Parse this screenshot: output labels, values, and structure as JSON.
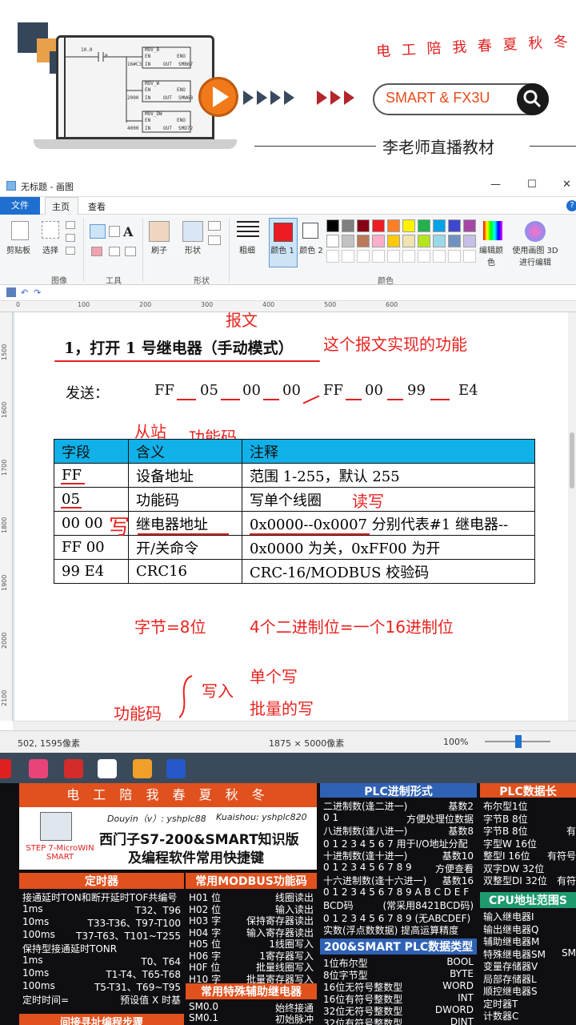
{
  "banner": {
    "slogan": "电 工 陪 我 春 夏 秋 冬",
    "search_text": "SMART & FX3U",
    "teacher": "李老师直播教材",
    "ladder": {
      "contact": "10.0",
      "p": "P",
      "blocks": [
        {
          "name": "MOV_B",
          "in_val": "16#C3",
          "out": "SMB67"
        },
        {
          "name": "MOV_W",
          "in_val": "2000",
          "out": "SMW68"
        },
        {
          "name": "MOV_DW",
          "in_val": "4000",
          "out": "SMD72"
        }
      ],
      "en": "EN",
      "eno": "ENO",
      "in_lbl": "IN",
      "out_lbl": "OUT"
    }
  },
  "window": {
    "title": "无标题 - 画图",
    "tabs": {
      "file": "文件",
      "home": "主页",
      "view": "查看"
    },
    "ribbon": {
      "clipboard": "剪贴板",
      "select": "选择",
      "image_group": "图像",
      "tools_group": "工具",
      "brush": "刷子",
      "shapes": "形状",
      "shapes_group": "形状",
      "size": "粗细",
      "color1": "颜色 1",
      "color2": "颜色 2",
      "colors_group": "颜色",
      "edit_colors": "编辑颜色",
      "paint3d": "使用画图 3D 进行编辑"
    },
    "palette": [
      "#000000",
      "#7f7f7f",
      "#880015",
      "#ed1c24",
      "#ff7f27",
      "#fff200",
      "#22b14c",
      "#00a2e8",
      "#3f48cc",
      "#a349a4",
      "#ffffff",
      "#c3c3c3",
      "#b97a57",
      "#ffaec9",
      "#ffc90e",
      "#efe4b0",
      "#b5e61d",
      "#99d9ea",
      "#7092be",
      "#c8bfe7"
    ],
    "ruler_h": [
      "0",
      "100",
      "200",
      "300",
      "400",
      "500",
      "600"
    ],
    "ruler_v": [
      "1500",
      "1600",
      "1700",
      "1800",
      "1900",
      "2000",
      "2100"
    ],
    "status": {
      "cursor": "502, 1595像素",
      "size": "1875 × 5000像素",
      "zoom": "100%"
    }
  },
  "doc": {
    "heading": "1，打开 1 号继电器（手动模式）",
    "send_label": "发送：",
    "hex_bytes": [
      "FF",
      "05",
      "00",
      "00",
      "FF",
      "00",
      "99",
      "E4"
    ],
    "table": {
      "headers": [
        "字段",
        "含义",
        "注释"
      ],
      "rows": [
        [
          "FF",
          "设备地址",
          "范围 1-255，默认 255"
        ],
        [
          "05",
          "功能码",
          "写单个线圈"
        ],
        [
          "00 00",
          "继电器地址",
          "0x0000--0x0007 分别代表#1 继电器--"
        ],
        [
          "FF 00",
          "开/关命令",
          "0x0000 为关，0xFF00 为开"
        ],
        [
          "99 E4",
          "CRC16",
          "CRC-16/MODBUS 校验码"
        ]
      ]
    },
    "annotations": {
      "baowen": "报文",
      "func_desc": "这个报文实现的功能",
      "slave": "从站",
      "func_code": "功能码",
      "rw": "读写",
      "write_char": "写",
      "byte_note": "字节=8位",
      "bit_note": "4个二进制位=一个16进制位",
      "single_write": "单个写",
      "write_in": "写入",
      "batch_write": "批量的写",
      "func_code2": "功能码"
    }
  },
  "bottom": {
    "banner_slogan": "电 工 陪 我 春 夏 秋 冬",
    "douyin": "Douyin（v）: yshplc88",
    "kuaishou": "Kuaishou: yshplc820",
    "title1": "西门子S7-200&SMART知识版",
    "title2": "及编程软件常用快捷键",
    "software": "STEP 7-MicroWIN SMART",
    "timer": {
      "title": "定时器",
      "rows": [
        [
          "接通延时TON和断开延时TOF共编号",
          ""
        ],
        [
          "1ms",
          "T32、T96"
        ],
        [
          "10ms",
          "T33-T36、T97-T100"
        ],
        [
          "100ms",
          "T37-T63、T101~T255"
        ],
        [
          "保持型接通延时TONR",
          ""
        ],
        [
          "1ms",
          "T0、T64"
        ],
        [
          "10ms",
          "T1-T4、T65-T68"
        ],
        [
          "100ms",
          "T5-T31、T69~T95"
        ],
        [
          "定时时间=",
          "预设值 X 时基"
        ]
      ]
    },
    "modbus": {
      "title": "常用MODBUS功能码",
      "rows": [
        [
          "H01 位",
          "线圈读出"
        ],
        [
          "H02 位",
          "输入读出"
        ],
        [
          "H03 字",
          "保持寄存器读出"
        ],
        [
          "H04 字",
          "输入寄存器读出"
        ],
        [
          "H05 位",
          "1线圈写入"
        ],
        [
          "H06 字",
          "1寄存器写入"
        ],
        [
          "H0F 位",
          "批量线圈写入"
        ],
        [
          "H10 字",
          "批量寄存器写入"
        ]
      ]
    },
    "aux": {
      "title": "常用特殊辅助继电器",
      "rows": [
        [
          "SM0.0",
          "始终接通"
        ],
        [
          "SM0.1",
          "初始脉冲"
        ]
      ]
    },
    "indirect": "间接寻址编程步骤",
    "plc_format": {
      "title": "PLC进制形式",
      "rows": [
        [
          "二进制数(逢二进一)",
          "基数2"
        ],
        [
          "0 1",
          "方便处理位数据"
        ],
        [
          "八进制数(逢八进一)",
          "基数8"
        ],
        [
          "0 1 2 3 4 5 6 7  用于I/O地址分配",
          ""
        ],
        [
          "十进制数(逢十进一)",
          "基数10"
        ],
        [
          "0 1 2 3 4 5 6 7 8 9",
          "方便查看"
        ],
        [
          "十六进制数(逢十六进一)",
          "基数16"
        ],
        [
          "0 1 2 3 4 5 6 7 8 9 A B C D E F",
          ""
        ],
        [
          "BCD码",
          "(常采用8421BCD码)"
        ],
        [
          "0 1 2 3 4 5 6 7 8 9 (无ABCDEF)",
          ""
        ],
        [
          "实数(浮点数数据)  提高运算精度",
          ""
        ]
      ]
    },
    "datatype": {
      "title": "200&SMART PLC数据类型",
      "rows": [
        [
          "1位布尔型",
          "BOOL"
        ],
        [
          "8位字节型",
          "BYTE"
        ],
        [
          "16位无符号整数型",
          "WORD"
        ],
        [
          "16位有符号整数型",
          "INT"
        ],
        [
          "32位无符号整数型",
          "DWORD"
        ],
        [
          "32位有符号整数型",
          "DINT"
        ]
      ]
    },
    "datalen": {
      "title": "PLC数据长",
      "rows": [
        [
          "布尔型1位",
          ""
        ],
        [
          "字节B 8位",
          ""
        ],
        [
          "字节B 8位",
          "有"
        ],
        [
          "字型W 16位",
          ""
        ],
        [
          "整型I 16位",
          "有符号"
        ],
        [
          "双字DW 32位",
          ""
        ],
        [
          "双整型DI 32位",
          "有符"
        ]
      ]
    },
    "cpu": {
      "title": "CPU地址范围S",
      "rows": [
        [
          "输入继电器I",
          ""
        ],
        [
          "输出继电器Q",
          ""
        ],
        [
          "辅助继电器M",
          ""
        ],
        [
          "特殊继电器SM",
          "SM"
        ],
        [
          "变量存储器V",
          ""
        ],
        [
          "局部存储器L",
          ""
        ],
        [
          "顺控继电器S",
          ""
        ],
        [
          "定时器T",
          ""
        ],
        [
          "计数器C",
          ""
        ]
      ]
    }
  }
}
